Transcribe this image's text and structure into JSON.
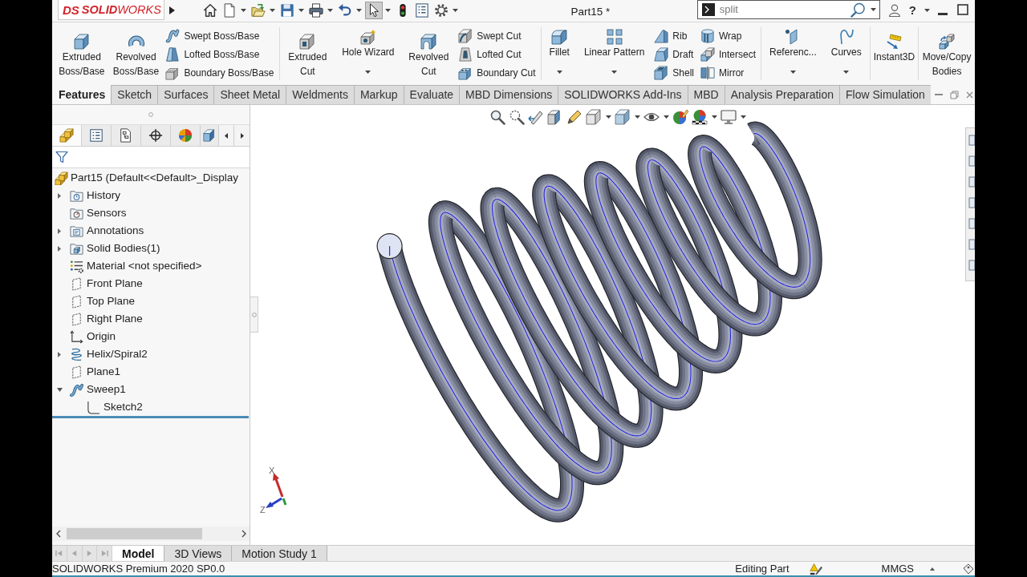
{
  "title_bar": {
    "logo_mark": "DS",
    "logo_wordmark": "**SOLID**WORKS",
    "document_title": "Part15 *",
    "search": {
      "value": "split"
    },
    "help": "?"
  },
  "quick_access": [
    {
      "kind": "home",
      "menu": false,
      "pressed": false
    },
    {
      "kind": "new",
      "menu": true,
      "pressed": false
    },
    {
      "kind": "open",
      "menu": true,
      "pressed": false
    },
    {
      "kind": "save",
      "menu": true,
      "pressed": false
    },
    {
      "kind": "print",
      "menu": true,
      "pressed": false
    },
    {
      "kind": "undo",
      "menu": true,
      "pressed": false
    },
    {
      "kind": "select",
      "menu": true,
      "pressed": true
    },
    {
      "kind": "rebuild",
      "menu": false,
      "pressed": false
    },
    {
      "kind": "properties",
      "menu": false,
      "pressed": false
    },
    {
      "kind": "options",
      "menu": true,
      "pressed": false
    }
  ],
  "command_manager": {
    "groups": [
      {
        "items": [
          {
            "kind": "large",
            "label": "Extruded Boss/Base",
            "menu": false
          },
          {
            "kind": "large",
            "label": "Revolved Boss/Base",
            "menu": false
          },
          {
            "kind": "stack",
            "commands": [
              {
                "label": "Swept Boss/Base"
              },
              {
                "label": "Lofted Boss/Base"
              },
              {
                "label": "Boundary Boss/Base"
              }
            ]
          }
        ]
      },
      {
        "items": [
          {
            "kind": "large",
            "label": "Extruded Cut",
            "menu": false
          },
          {
            "kind": "large",
            "label": "Hole Wizard",
            "menu": true
          },
          {
            "kind": "large",
            "label": "Revolved Cut",
            "menu": false
          },
          {
            "kind": "stack",
            "commands": [
              {
                "label": "Swept Cut"
              },
              {
                "label": "Lofted Cut"
              },
              {
                "label": "Boundary Cut"
              }
            ]
          }
        ]
      },
      {
        "items": [
          {
            "kind": "large",
            "label": "Fillet",
            "menu": true
          },
          {
            "kind": "large",
            "label": "Linear Pattern",
            "menu": true
          },
          {
            "kind": "stack",
            "commands": [
              {
                "label": "Rib"
              },
              {
                "label": "Draft"
              },
              {
                "label": "Shell"
              }
            ]
          },
          {
            "kind": "stack",
            "commands": [
              {
                "label": "Wrap"
              },
              {
                "label": "Intersect"
              },
              {
                "label": "Mirror"
              }
            ]
          }
        ]
      },
      {
        "items": [
          {
            "kind": "large",
            "label": "Referenc...",
            "menu": true
          },
          {
            "kind": "large",
            "label": "Curves",
            "menu": true
          }
        ]
      },
      {
        "items": [
          {
            "kind": "large",
            "label": "Instant3D",
            "menu": false
          }
        ]
      },
      {
        "items": [
          {
            "kind": "large",
            "label": "Move/Copy Bodies",
            "menu": false
          }
        ]
      }
    ]
  },
  "command_tabs": [
    {
      "label": "Features",
      "selected": true
    },
    {
      "label": "Sketch",
      "selected": false
    },
    {
      "label": "Surfaces",
      "selected": false
    },
    {
      "label": "Sheet Metal",
      "selected": false
    },
    {
      "label": "Weldments",
      "selected": false
    },
    {
      "label": "Markup",
      "selected": false
    },
    {
      "label": "Evaluate",
      "selected": false
    },
    {
      "label": "MBD Dimensions",
      "selected": false
    },
    {
      "label": "SOLIDWORKS Add-Ins",
      "selected": false
    },
    {
      "label": "MBD",
      "selected": false
    },
    {
      "label": "Analysis Preparation",
      "selected": false
    },
    {
      "label": "Flow Simulation",
      "selected": false
    }
  ],
  "feature_manager": {
    "tabs": [
      {
        "kind": "features",
        "selected": true
      },
      {
        "kind": "properties",
        "selected": false
      },
      {
        "kind": "configurations",
        "selected": false
      },
      {
        "kind": "dimxpert",
        "selected": false
      },
      {
        "kind": "display",
        "selected": false
      },
      {
        "kind": "plugin",
        "selected": false
      }
    ],
    "tree": {
      "kind": "part",
      "label": "Part15 (Default<<Default>_Display",
      "children": [
        {
          "kind": "history",
          "label": "History",
          "expanded": false
        },
        {
          "kind": "sensors",
          "label": "Sensors"
        },
        {
          "kind": "annotations",
          "label": "Annotations",
          "expanded": false
        },
        {
          "kind": "bodies",
          "label": "Solid Bodies(1)",
          "expanded": false
        },
        {
          "kind": "material",
          "label": "Material <not specified>"
        },
        {
          "kind": "plane",
          "label": "Front Plane"
        },
        {
          "kind": "plane",
          "label": "Top Plane"
        },
        {
          "kind": "plane",
          "label": "Right Plane"
        },
        {
          "kind": "origin",
          "label": "Origin"
        },
        {
          "kind": "helix",
          "label": "Helix/Spiral2",
          "expanded": false
        },
        {
          "kind": "plane",
          "label": "Plane1"
        },
        {
          "kind": "sweep",
          "label": "Sweep1",
          "expanded": true,
          "children": [
            {
              "kind": "sketch",
              "label": "Sketch2"
            }
          ]
        }
      ]
    }
  },
  "viewport": {
    "triad": {
      "x_label": "X",
      "z_label": "Z"
    }
  },
  "bottom_tabs": [
    {
      "label": "Model",
      "selected": true
    },
    {
      "label": "3D Views",
      "selected": false
    },
    {
      "label": "Motion Study 1",
      "selected": false
    }
  ],
  "status_bar": {
    "product": "SOLIDWORKS Premium 2020 SP0.0",
    "mode": "Editing Part",
    "units": "MMGS"
  }
}
